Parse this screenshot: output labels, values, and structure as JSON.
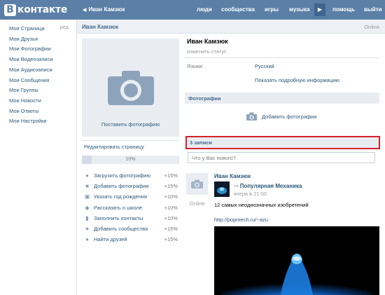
{
  "header": {
    "logo_letter": "В",
    "logo_text": "контакте",
    "back_label": "Иван Камзюк",
    "nav": [
      "люди",
      "сообщества",
      "игры",
      "музыка",
      "помощь",
      "выйти"
    ],
    "bg_color": "#5b7fa6"
  },
  "sidebar": {
    "edit_label": "ред.",
    "items": [
      {
        "label": "Моя Страница"
      },
      {
        "label": "Мои Друзья"
      },
      {
        "label": "Мои Фотографии"
      },
      {
        "label": "Мои Видеозаписи"
      },
      {
        "label": "Мои Аудиозаписи"
      },
      {
        "label": "Мои Сообщения"
      },
      {
        "label": "Мои Группы"
      },
      {
        "label": "Мои Новости"
      },
      {
        "label": "Мои Ответы"
      },
      {
        "label": "Мои Настройки"
      }
    ]
  },
  "page": {
    "title": "Иван Камзюк",
    "online": "Online"
  },
  "profile": {
    "upload_photo": "Поставить фотографию",
    "edit_page": "Редактировать страницу",
    "completion": "10%",
    "completion_fraction": 0.1,
    "tasks": [
      {
        "icon": "user-icon",
        "label": "Загрузить фотографию",
        "pct": "+15%"
      },
      {
        "icon": "camera-icon",
        "label": "Добавить фотографии",
        "pct": "+15%"
      },
      {
        "icon": "gift-icon",
        "label": "Указать год рождения",
        "pct": "+10%"
      },
      {
        "icon": "school-icon",
        "label": "Рассказать о школе",
        "pct": "+10%"
      },
      {
        "icon": "phone-icon",
        "label": "Заполнить контакты",
        "pct": "+10%"
      },
      {
        "icon": "star-icon",
        "label": "Добавить сообщества",
        "pct": "+15%"
      },
      {
        "icon": "friends-icon",
        "label": "Найти друзей",
        "pct": "+15%"
      }
    ]
  },
  "info": {
    "name": "Иван Камзюк",
    "status": "изменить статус",
    "lang_label": "Языки:",
    "lang_value": "Русский",
    "more": "Показать подробную информацию"
  },
  "photos": {
    "header": "Фотографии",
    "add": "Добавить фотографии"
  },
  "wall": {
    "header": "3 записи",
    "placeholder": "Что у Вас нового?",
    "highlight_color": "#d6212b"
  },
  "post": {
    "author": "Иван Камзюк",
    "online": "Online",
    "repost_source": "Популярная Механика",
    "repost_time": "вчера в 21:00",
    "text": "12 самых неоднозначных изобретений",
    "link": "http://popmech.ru/~azu"
  }
}
